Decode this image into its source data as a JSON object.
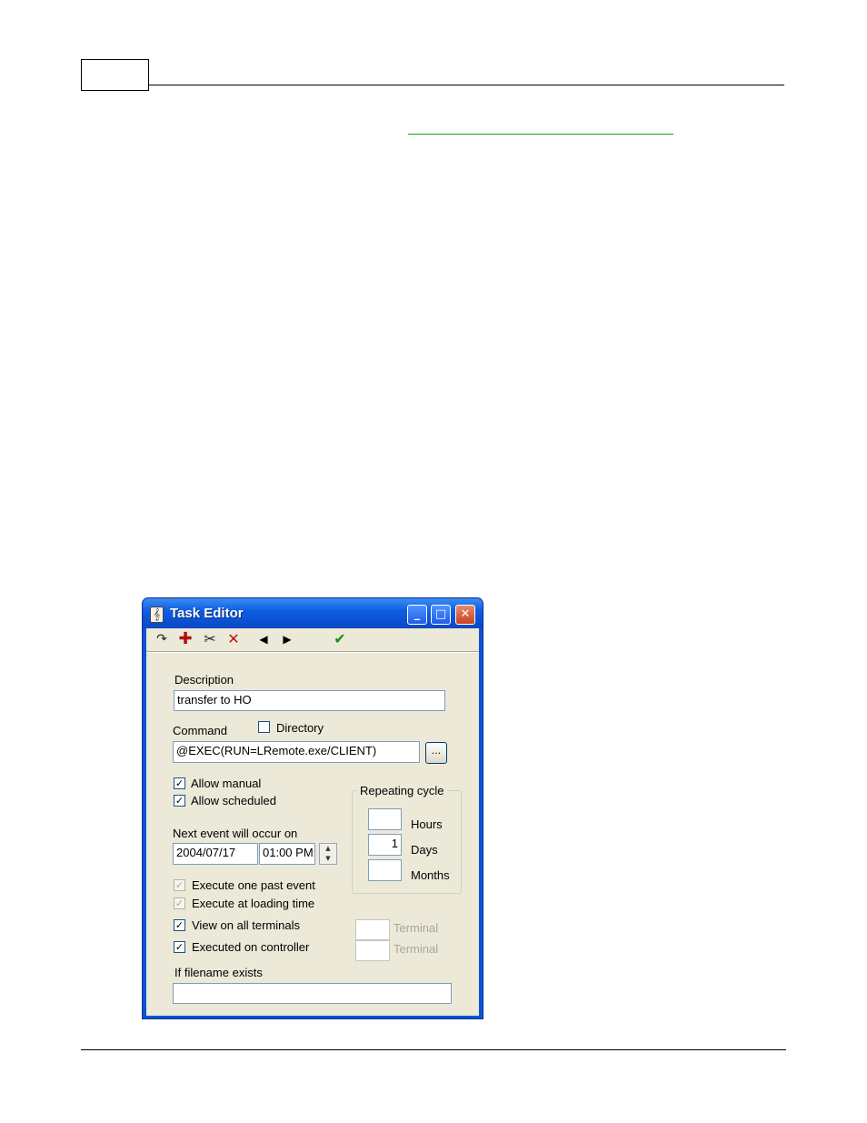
{
  "window": {
    "title": "Task Editor",
    "controls": {
      "minimize": "_",
      "maximize": "□",
      "close": "✕"
    }
  },
  "toolbar": {
    "icons": [
      "repeat-arrow-icon",
      "add-icon",
      "cut-icon",
      "delete-icon",
      "prev-icon",
      "next-icon",
      "confirm-icon"
    ],
    "glyphs": {
      "repeat": "↷",
      "add": "✚",
      "cut": "✂",
      "delete": "✕",
      "prev": "◀",
      "next": "▶",
      "confirm": "✔"
    }
  },
  "form": {
    "description_label": "Description",
    "description_value": "transfer to HO",
    "command_label": "Command",
    "directory_label": "Directory",
    "directory_checked": false,
    "command_value": "@EXEC(RUN=LRemote.exe/CLIENT)",
    "browse_label": "...",
    "allow_manual_label": "Allow manual",
    "allow_manual_checked": true,
    "allow_scheduled_label": "Allow scheduled",
    "allow_scheduled_checked": true,
    "next_event_label": "Next event will occur on",
    "date_value": "2004/07/17",
    "time_value": "01:00 PM",
    "repeating_cycle_label": "Repeating cycle",
    "hours_label": "Hours",
    "hours_value": "",
    "days_label": "Days",
    "days_value": "1",
    "months_label": "Months",
    "months_value": "",
    "execute_past_label": "Execute one past event",
    "execute_loading_label": "Execute at loading time",
    "view_all_label": "View on all terminals",
    "executed_controller_label": "Executed on controller",
    "terminal_label_1": "Terminal",
    "terminal_label_2": "Terminal",
    "filename_label": "If filename exists",
    "filename_value": "",
    "check_mark": "✓"
  },
  "colors": {
    "titlebar": "#0a53d6",
    "dialog_bg": "#ece9d8",
    "add_icon": "#b01010",
    "delete_icon": "#c01010",
    "confirm_icon": "#1a8a1a",
    "link_underline": "#11a011"
  }
}
